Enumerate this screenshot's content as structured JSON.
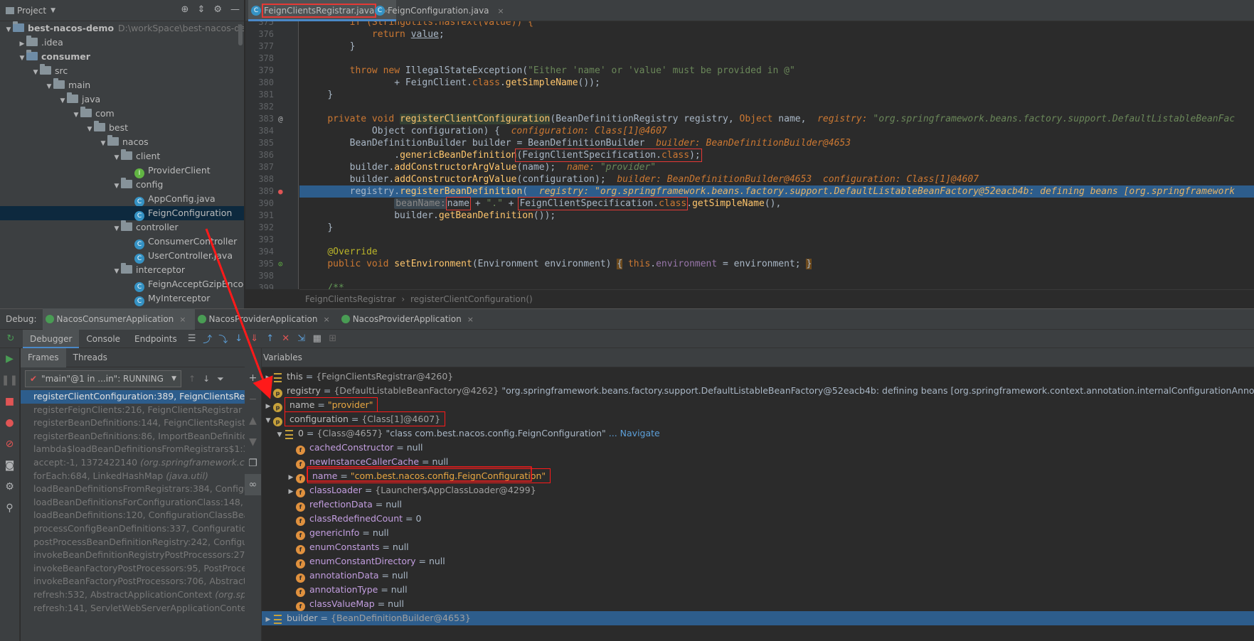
{
  "project": {
    "title": "Project",
    "tree": [
      {
        "label": "best-nacos-demo",
        "extra": "D:\\workSpace\\best-nacos-demo",
        "icon": "module-folder-icon",
        "depth": 0,
        "expanded": true,
        "bold": true
      },
      {
        "label": ".idea",
        "icon": "folder-icon",
        "depth": 1,
        "expanded": false
      },
      {
        "label": "consumer",
        "icon": "module-folder-icon",
        "depth": 1,
        "expanded": true,
        "bold": true
      },
      {
        "label": "src",
        "icon": "folder-icon",
        "depth": 2,
        "expanded": true
      },
      {
        "label": "main",
        "icon": "folder-icon",
        "depth": 3,
        "expanded": true
      },
      {
        "label": "java",
        "icon": "folder-icon",
        "depth": 4,
        "expanded": true
      },
      {
        "label": "com",
        "icon": "folder-icon",
        "depth": 5,
        "expanded": true
      },
      {
        "label": "best",
        "icon": "folder-icon",
        "depth": 6,
        "expanded": true
      },
      {
        "label": "nacos",
        "icon": "folder-icon",
        "depth": 7,
        "expanded": true
      },
      {
        "label": "client",
        "icon": "folder-icon",
        "depth": 8,
        "expanded": true
      },
      {
        "label": "ProviderClient",
        "icon": "interface-icon",
        "depth": 9
      },
      {
        "label": "config",
        "icon": "folder-icon",
        "depth": 8,
        "expanded": true
      },
      {
        "label": "AppConfig.java",
        "icon": "class-icon",
        "depth": 9
      },
      {
        "label": "FeignConfiguration",
        "icon": "class-icon",
        "depth": 9,
        "selected": true
      },
      {
        "label": "controller",
        "icon": "folder-icon",
        "depth": 8,
        "expanded": true
      },
      {
        "label": "ConsumerController",
        "icon": "class-icon",
        "depth": 9
      },
      {
        "label": "UserController.java",
        "icon": "class-icon",
        "depth": 9
      },
      {
        "label": "interceptor",
        "icon": "folder-icon",
        "depth": 8,
        "expanded": true
      },
      {
        "label": "FeignAcceptGzipEncoding",
        "icon": "class-icon",
        "depth": 9
      },
      {
        "label": "MyInterceptor",
        "icon": "class-icon",
        "depth": 9
      }
    ]
  },
  "editor": {
    "tabs": [
      {
        "label": "FeignClientsRegistrar.java",
        "active": true
      },
      {
        "label": "FeignConfiguration.java",
        "active": false
      }
    ],
    "close_glyph": "×",
    "line_numbers": [
      "375",
      "376",
      "377",
      "378",
      "379",
      "380",
      "381",
      "382",
      "383",
      "384",
      "385",
      "386",
      "387",
      "388",
      "389",
      "390",
      "391",
      "392",
      "393",
      "394",
      "395",
      "398",
      "399"
    ],
    "breadcrumb": [
      "FeignClientsRegistrar",
      "registerClientConfiguration()"
    ]
  },
  "debug": {
    "label": "Debug:",
    "run_tabs": [
      {
        "label": "NacosConsumerApplication",
        "active": true
      },
      {
        "label": "NacosProviderApplication",
        "active": false
      },
      {
        "label": "NacosProviderApplication",
        "active": false
      }
    ],
    "sub_tabs": [
      "Debugger",
      "Console",
      "Endpoints"
    ],
    "frames_tabs": [
      "Frames",
      "Threads"
    ],
    "thread": "\"main\"@1 in ...in\": RUNNING",
    "frames": [
      {
        "text": "registerClientConfiguration:389, FeignClientsRegistrar",
        "pkg": "",
        "selected": true
      },
      {
        "text": "registerFeignClients:216, FeignClientsRegistrar ",
        "pkg": "(org."
      },
      {
        "text": "registerBeanDefinitions:144, FeignClientsRegistrar ",
        "pkg": "(o"
      },
      {
        "text": "registerBeanDefinitions:86, ImportBeanDefinitionRe",
        "pkg": ""
      },
      {
        "text": "lambda$loadBeanDefinitionsFromRegistrars$1:385",
        "pkg": ""
      },
      {
        "text": "accept:-1, 1372422140 ",
        "pkg": "(org.springframework.conte"
      },
      {
        "text": "forEach:684, LinkedHashMap ",
        "pkg": "(java.util)"
      },
      {
        "text": "loadBeanDefinitionsFromRegistrars:384, Configura",
        "pkg": ""
      },
      {
        "text": "loadBeanDefinitionsForConfigurationClass:148, Co",
        "pkg": ""
      },
      {
        "text": "loadBeanDefinitions:120, ConfigurationClassBeanD",
        "pkg": ""
      },
      {
        "text": "processConfigBeanDefinitions:337, ConfigurationC",
        "pkg": ""
      },
      {
        "text": "postProcessBeanDefinitionRegistry:242, Configurat",
        "pkg": ""
      },
      {
        "text": "invokeBeanDefinitionRegistryPostProcessors:275, P",
        "pkg": ""
      },
      {
        "text": "invokeBeanFactoryPostProcessors:95, PostProcess",
        "pkg": ""
      },
      {
        "text": "invokeBeanFactoryPostProcessors:706, AbstractAp",
        "pkg": ""
      },
      {
        "text": "refresh:532, AbstractApplicationContext ",
        "pkg": "(org.spring"
      },
      {
        "text": "refresh:141, ServletWebServerApplicationContext ",
        "pkg": "("
      }
    ],
    "variables_title": "Variables",
    "variables": [
      {
        "depth": 0,
        "toggle": "▶",
        "icon": "list",
        "name": "this",
        "eq": " = ",
        "type": "{FeignClientsRegistrar@4260}",
        "value": "",
        "boxed": false
      },
      {
        "depth": 0,
        "toggle": "▶",
        "icon": "p",
        "name": "registry",
        "eq": " = ",
        "type": "{DefaultListableBeanFactory@4262}",
        "value": " \"org.springframework.beans.factory.support.DefaultListableBeanFactory@52eacb4b: defining beans [org.springframework.context.annotation.internalConfigurationAnnotationProcessor,org",
        "boxed": false
      },
      {
        "depth": 0,
        "toggle": "▶",
        "icon": "p",
        "name": "name",
        "eq": " = ",
        "type": "",
        "value": "\"provider\"",
        "valueStr": true,
        "boxed": true
      },
      {
        "depth": 0,
        "toggle": "▼",
        "icon": "p",
        "name": "configuration",
        "eq": " = ",
        "type": "{Class[1]@4607}",
        "value": "",
        "boxed": true
      },
      {
        "depth": 1,
        "toggle": "▼",
        "icon": "list",
        "name": "0",
        "eq": " = ",
        "type": "{Class@4657}",
        "value": " \"class com.best.nacos.config.FeignConfiguration\"",
        "link": "... Navigate",
        "boxed": false
      },
      {
        "depth": 2,
        "toggle": "",
        "icon": "f",
        "name": "cachedConstructor",
        "eq": " = ",
        "type": "",
        "value": "null",
        "boxed": false
      },
      {
        "depth": 2,
        "toggle": "",
        "icon": "f",
        "name": "newInstanceCallerCache",
        "eq": " = ",
        "type": "",
        "value": "null",
        "boxed": false
      },
      {
        "depth": 2,
        "toggle": "▶",
        "icon": "f",
        "name": "name",
        "eq": " = ",
        "type": "",
        "value": "\"com.best.nacos.config.FeignConfiguration\"",
        "valueStr": true,
        "boxed": true
      },
      {
        "depth": 2,
        "toggle": "▶",
        "icon": "f",
        "name": "classLoader",
        "eq": " = ",
        "type": "{Launcher$AppClassLoader@4299}",
        "value": "",
        "boxed": false
      },
      {
        "depth": 2,
        "toggle": "",
        "icon": "f",
        "name": "reflectionData",
        "eq": " = ",
        "type": "",
        "value": "null",
        "boxed": false
      },
      {
        "depth": 2,
        "toggle": "",
        "icon": "f",
        "name": "classRedefinedCount",
        "eq": " = ",
        "type": "",
        "value": "0",
        "boxed": false
      },
      {
        "depth": 2,
        "toggle": "",
        "icon": "f",
        "name": "genericInfo",
        "eq": " = ",
        "type": "",
        "value": "null",
        "boxed": false
      },
      {
        "depth": 2,
        "toggle": "",
        "icon": "f",
        "name": "enumConstants",
        "eq": " = ",
        "type": "",
        "value": "null",
        "boxed": false
      },
      {
        "depth": 2,
        "toggle": "",
        "icon": "f",
        "name": "enumConstantDirectory",
        "eq": " = ",
        "type": "",
        "value": "null",
        "boxed": false
      },
      {
        "depth": 2,
        "toggle": "",
        "icon": "f",
        "name": "annotationData",
        "eq": " = ",
        "type": "",
        "value": "null",
        "boxed": false
      },
      {
        "depth": 2,
        "toggle": "",
        "icon": "f",
        "name": "annotationType",
        "eq": " = ",
        "type": "",
        "value": "null",
        "boxed": false
      },
      {
        "depth": 2,
        "toggle": "",
        "icon": "f",
        "name": "classValueMap",
        "eq": " = ",
        "type": "",
        "value": "null",
        "boxed": false
      },
      {
        "depth": 0,
        "toggle": "▶",
        "icon": "list",
        "name": "builder",
        "eq": " = ",
        "type": "{BeanDefinitionBuilder@4653}",
        "value": "",
        "boxed": false,
        "selected": true
      }
    ]
  },
  "code": {
    "l375a": "if (StringUtils.hasText(value)) {",
    "l376_kw": "return ",
    "l376_v": "value",
    "l376_e": ";",
    "l377": "}",
    "l379_kw": "throw new ",
    "l379_t": "IllegalStateException(",
    "l379_s": "\"Either 'name' or 'value' must be provided in @\"",
    "l380_a": "+ ",
    "l380_t": "FeignClient",
    "l380_b": ".",
    "l380_kw": "class",
    "l380_c": ".",
    "l380_m": "getSimpleName",
    "l380_d": "());",
    "l381": "}",
    "l383_kw": "private void ",
    "l383_m": "registerClientConfiguration",
    "l383_a": "(",
    "l383_t": "BeanDefinitionRegistry",
    "l383_b": " registry, ",
    "l383_t2": "Object",
    "l383_c": " name,  ",
    "l383_h": "registry: ",
    "l383_hv": "\"org.springframework.beans.factory.support.DefaultListableBeanFac",
    "l384_t": "Object",
    "l384_a": " configuration) {  ",
    "l384_h": "configuration: Class[1]@4607",
    "l385_t": "BeanDefinitionBuilder",
    "l385_a": " builder = ",
    "l385_t2": "BeanDefinitionBuilder",
    "l385_h": "  builder: BeanDefinitionBuilder@4653",
    "l386_a": ".",
    "l386_m": "genericBeanDefinition",
    "l386_b": "(",
    "l386_t": "FeignClientSpecification",
    "l386_c": ".",
    "l386_kw": "class",
    "l386_d": ");",
    "l387_a": "builder.",
    "l387_m": "addConstructorArgValue",
    "l387_b": "(name);  ",
    "l387_h": "name: ",
    "l387_hv": "\"provider\"",
    "l388_a": "builder.",
    "l388_m": "addConstructorArgValue",
    "l388_b": "(configuration);  ",
    "l388_h": "builder: BeanDefinitionBuilder@4653  configuration: Class[1]@4607",
    "l389_a": "registry.",
    "l389_m": "registerBeanDefinition",
    "l389_b": "(  ",
    "l389_h": "registry: ",
    "l389_hv": "\"org.springframework.beans.factory.support.DefaultListableBeanFactory@52eacb4b: defining beans [org.springframework",
    "l390_hint": "beanName:",
    "l390_n": "name",
    "l390_a": " + ",
    "l390_s": "\".\"",
    "l390_b": " + ",
    "l390_t": "FeignClientSpecification",
    "l390_c": ".",
    "l390_kw": "class",
    "l390_d": ".",
    "l390_m": "getSimpleName",
    "l390_e": "(),",
    "l391_a": "builder.",
    "l391_m": "getBeanDefinition",
    "l391_b": "());",
    "l392": "}",
    "l394": "@Override",
    "l395_kw": "public void ",
    "l395_m": "setEnvironment",
    "l395_a": "(",
    "l395_t": "Environment",
    "l395_b": " environment) ",
    "l395_c": "{",
    "l395_kw2": " this",
    "l395_d": ".",
    "l395_f": "environment",
    "l395_e": " = environment; ",
    "l395_g": "}",
    "l399": "/**"
  }
}
